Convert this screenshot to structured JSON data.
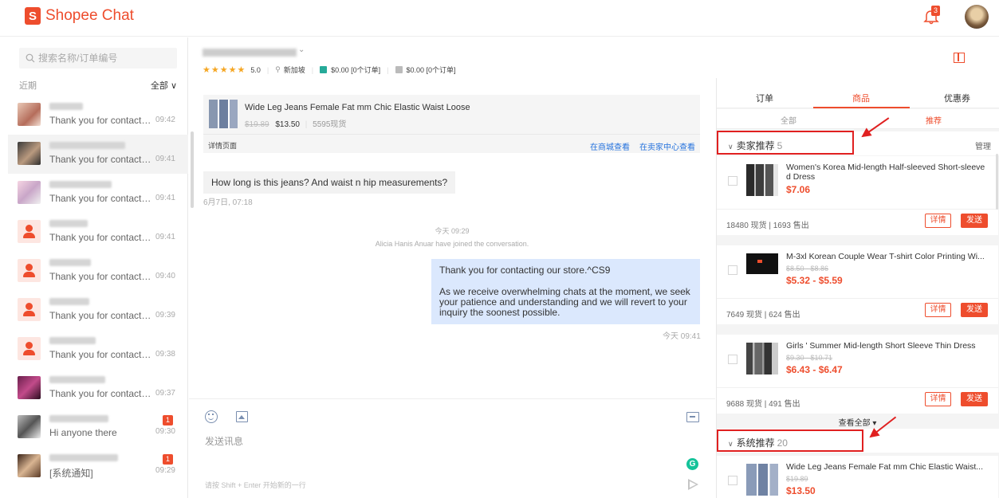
{
  "app": {
    "logo_glyph": "S",
    "title": "Shopee Chat",
    "notification_count": "3"
  },
  "sidebar": {
    "search_placeholder": "搜索名称/订单编号",
    "recent_label": "近期",
    "filter_label": "全部 ∨",
    "chats": [
      {
        "preview": "Thank you for contactin...",
        "time": "09:42",
        "avatar": "photo-a",
        "unread": ""
      },
      {
        "preview": "Thank you for contactin...",
        "time": "09:41",
        "avatar": "photo-b",
        "unread": ""
      },
      {
        "preview": "Thank you for contactin...",
        "time": "09:41",
        "avatar": "photo-c",
        "unread": ""
      },
      {
        "preview": "Thank you for contactin...",
        "time": "09:41",
        "avatar": "generic",
        "unread": ""
      },
      {
        "preview": "Thank you for contactin...",
        "time": "09:40",
        "avatar": "generic",
        "unread": ""
      },
      {
        "preview": "Thank you for contactin...",
        "time": "09:39",
        "avatar": "generic",
        "unread": ""
      },
      {
        "preview": "Thank you for contactin...",
        "time": "09:38",
        "avatar": "generic",
        "unread": ""
      },
      {
        "preview": "Thank you for contactin...",
        "time": "09:37",
        "avatar": "photo-d",
        "unread": ""
      },
      {
        "preview": "Hi anyone there",
        "time": "09:30",
        "avatar": "photo-e",
        "unread": "1"
      },
      {
        "preview": "[系统通知]",
        "time": "09:29",
        "avatar": "photo-f",
        "unread": "1"
      }
    ]
  },
  "conversation": {
    "rating": "5.0",
    "location": "新加坡",
    "stat_paid": "$0.00 [0个订单]",
    "stat_other": "$0.00 [0个订单]",
    "product": {
      "title": "Wide Leg Jeans Female Fat mm Chic Elastic Waist Loose",
      "old_price": "$19.89",
      "price": "$13.50",
      "stock": "5595现货",
      "detail_label": "详情页面",
      "view_mall": "在商城查看",
      "view_seller": "在卖家中心查看"
    },
    "incoming_message": "How long is this jeans? And waist n hip measurements?",
    "incoming_time": "6月7日, 07:18",
    "system_time": "今天 09:29",
    "system_join": "Alicia Hanis Anuar have joined the conversation.",
    "outgoing_p1": "Thank you for contacting our store.^CS9",
    "outgoing_p2": "As we receive overwhelming chats at the moment, we seek your patience and understanding and we will revert to your inquiry the soonest possible.",
    "outgoing_time": "今天 09:41",
    "composer_placeholder": "发送讯息",
    "shift_hint": "请按 Shift + Enter 开始新的一行"
  },
  "right_panel": {
    "tabs": [
      "订单",
      "商品",
      "优惠券"
    ],
    "subtabs": [
      "全部",
      "推荐"
    ],
    "seller_section": {
      "title": "卖家推荐",
      "count": "5",
      "manage": "管理"
    },
    "system_section": {
      "title": "系统推荐",
      "count": "20"
    },
    "view_all": "查看全部 ▾",
    "detail_btn": "详情",
    "send_btn": "发送",
    "items": [
      {
        "title": "Women's Korea Mid-length Half-sleeved Short-sleeve d Dress",
        "old_price": "",
        "price": "$7.06",
        "stats": "18480 现货 | 1693 售出"
      },
      {
        "title": "M-3xl Korean Couple Wear T-shirt Color Printing Wi...",
        "old_price": "$8.50 - $8.86",
        "price": "$5.32 - $5.59",
        "stats": "7649 现货 | 624 售出"
      },
      {
        "title": "Girls ' Summer Mid-length Short Sleeve Thin Dress",
        "old_price": "$9.30 - $10.71",
        "price": "$6.43 - $6.47",
        "stats": "9688 现货 | 491 售出"
      },
      {
        "title": "Wide Leg Jeans Female Fat mm Chic Elastic Waist...",
        "old_price": "$19.89",
        "price": "$13.50",
        "stats": ""
      }
    ]
  },
  "colors": {
    "brand": "#ee4d2d",
    "link": "#2673dd",
    "bubble_out": "#dbe8fd",
    "annotation": "#e02020"
  }
}
